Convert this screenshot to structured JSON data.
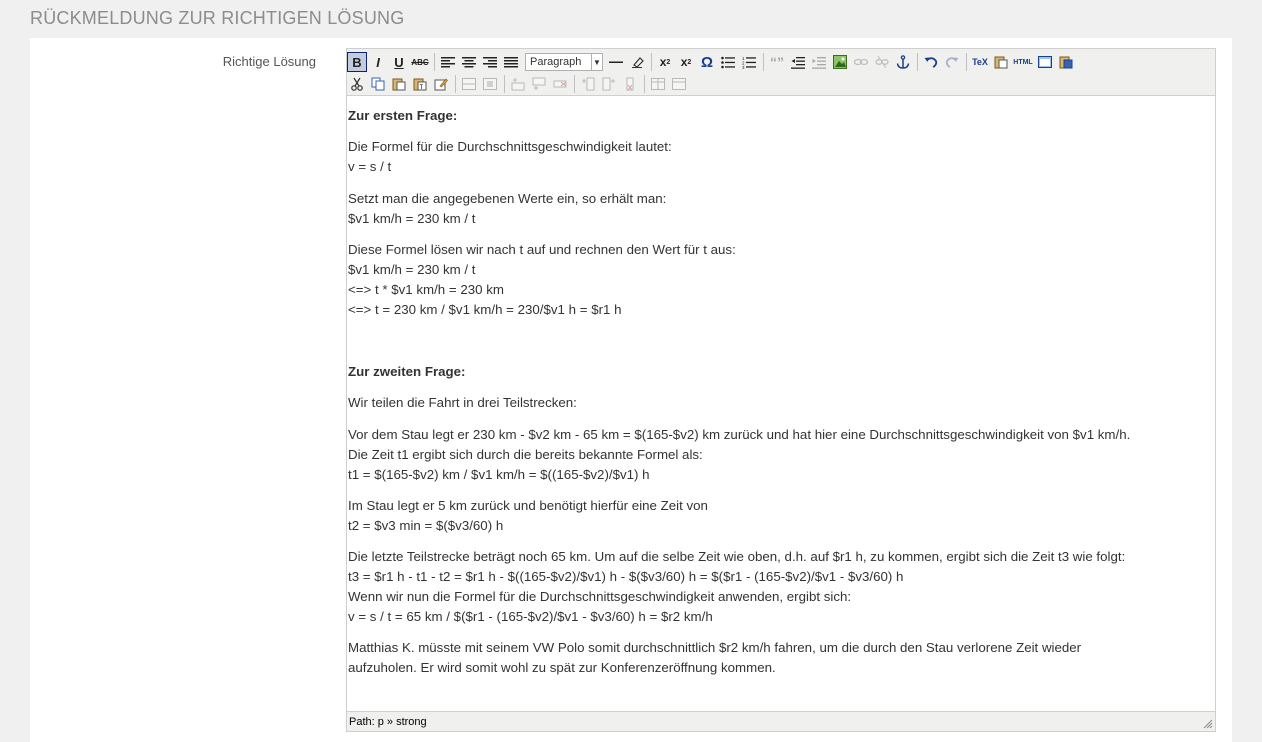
{
  "section_title": "RÜCKMELDUNG ZUR RICHTIGEN LÖSUNG",
  "field_label": "Richtige Lösung",
  "toolbar": {
    "format_select_value": "Paragraph",
    "tex_label": "TeX",
    "html_label": "HTML"
  },
  "content": {
    "q1_heading": "Zur ersten Frage:",
    "q1_p1_l1": "Die Formel für die Durchschnittsgeschwindigkeit lautet:",
    "q1_p1_l2": "v = s / t",
    "q1_p2_l1": "Setzt man die angegebenen Werte ein, so erhält man:",
    "q1_p2_l2": "$v1 km/h = 230 km / t",
    "q1_p3_l1": "Diese Formel lösen wir nach t auf und rechnen den Wert für t aus:",
    "q1_p3_l2": "$v1 km/h = 230 km / t",
    "q1_p3_l3": "<=> t * $v1 km/h = 230 km",
    "q1_p3_l4": "<=> t = 230 km / $v1 km/h = 230/$v1 h = $r1 h",
    "q2_heading": "Zur zweiten Frage:",
    "q2_p1": "Wir teilen die Fahrt in drei Teilstrecken:",
    "q2_p2_l1": "Vor dem Stau legt er 230 km - $v2 km - 65 km = $(165-$v2) km zurück und hat hier eine Durchschnittsgeschwindigkeit von $v1 km/h.",
    "q2_p2_l2": "Die Zeit t1 ergibt sich durch die bereits bekannte Formel als:",
    "q2_p2_l3": "t1 = $(165-$v2) km / $v1 km/h = $((165-$v2)/$v1) h",
    "q2_p3_l1": "Im Stau legt er 5 km zurück und benötigt hierfür eine Zeit von",
    "q2_p3_l2": "t2 = $v3 min = $($v3/60) h",
    "q2_p4_l1": "Die letzte Teilstrecke beträgt noch 65 km. Um auf die selbe Zeit wie oben, d.h. auf $r1 h, zu kommen, ergibt sich die Zeit t3 wie folgt:",
    "q2_p4_l2": "t3 = $r1 h - t1 - t2 = $r1 h - $((165-$v2)/$v1) h - $($v3/60) h = $($r1 - (165-$v2)/$v1 - $v3/60) h",
    "q2_p4_l3": "Wenn wir nun die Formel für die Durchschnittsgeschwindigkeit anwenden, ergibt sich:",
    "q2_p4_l4": "v = s / t = 65 km / $($r1 - (165-$v2)/$v1 - $v3/60) h = $r2 km/h",
    "q2_p5_l1": "Matthias K. müsste mit seinem VW Polo somit durchschnittlich $r2 km/h fahren, um die durch den Stau verlorene Zeit wieder",
    "q2_p5_l2": "aufzuholen. Er wird somit wohl zu spät zur Konferenzeröffnung kommen."
  },
  "statusbar": {
    "path_text": "Path: p » strong"
  },
  "colors": {
    "page_bg": "#f0f0f0",
    "toolbar_bg": "#f0f0ee",
    "active_btn": "#c2cbe0",
    "section_title": "#8c8c8c"
  }
}
